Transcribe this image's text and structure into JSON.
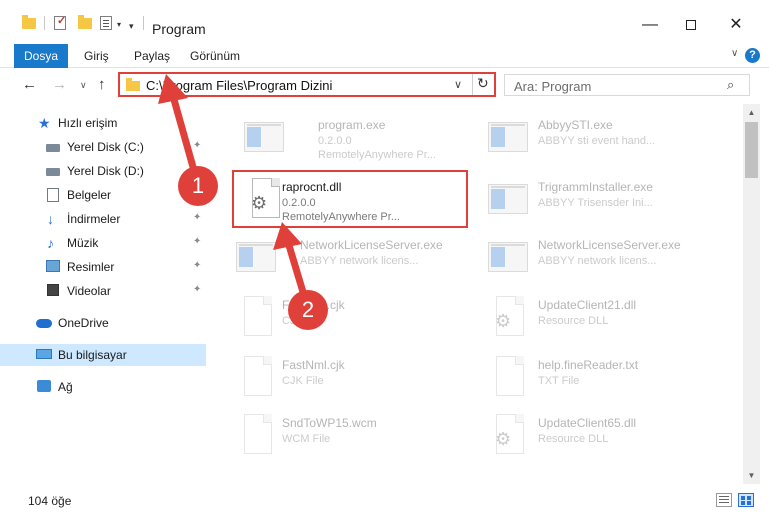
{
  "window": {
    "title": "Program",
    "minimize_glyph": "—",
    "close_glyph": "✕"
  },
  "ribbon": {
    "tabs": [
      "Dosya",
      "Giriş",
      "Paylaş",
      "Görünüm"
    ],
    "expand_glyph": "∨",
    "help_glyph": "?"
  },
  "nav": {
    "back_glyph": "←",
    "forward_glyph": "→",
    "recent_glyph": "∨",
    "up_glyph": "↑",
    "address": "C:\\Program Files\\Program Dizini",
    "dropdown_glyph": "∨",
    "refresh_glyph": "↻",
    "search_placeholder": "Ara: Program",
    "search_glyph": "⌕"
  },
  "sidebar": {
    "items": [
      {
        "label": "Hızlı erişim",
        "icon": "star-icon",
        "pinned": false
      },
      {
        "label": "Yerel Disk (C:)",
        "icon": "drive-icon",
        "pinned": true
      },
      {
        "label": "Yerel Disk (D:)",
        "icon": "drive-icon",
        "pinned": false
      },
      {
        "label": "Belgeler",
        "icon": "documents-icon",
        "pinned": true
      },
      {
        "label": "İndirmeler",
        "icon": "download-icon",
        "pinned": true
      },
      {
        "label": "Müzik",
        "icon": "music-icon",
        "pinned": true
      },
      {
        "label": "Resimler",
        "icon": "pictures-icon",
        "pinned": true
      },
      {
        "label": "Videolar",
        "icon": "videos-icon",
        "pinned": true
      },
      {
        "label": "OneDrive",
        "icon": "cloud-icon",
        "pinned": false
      },
      {
        "label": "Bu bilgisayar",
        "icon": "computer-icon",
        "pinned": false,
        "selected": true
      },
      {
        "label": "Ağ",
        "icon": "network-icon",
        "pinned": false
      }
    ],
    "pin_glyph": "📌"
  },
  "files": [
    {
      "name": "program.exe",
      "line1": "0.2.0.0",
      "line2": "RemotelyAnywhere Pr...",
      "icon": "installer-icon",
      "faded": true
    },
    {
      "name": "AbbyySTI.exe",
      "line1": "ABBYY sti event hand...",
      "line2": "",
      "icon": "application-icon",
      "faded": true
    },
    {
      "name": "raprocnt.dll",
      "line1": "0.2.0.0",
      "line2": "RemotelyAnywhere Pr...",
      "icon": "dll-gear-icon",
      "faded": false
    },
    {
      "name": "TrigrammInstaller.exe",
      "line1": "ABBYY Trisensder Ini...",
      "line2": "",
      "icon": "application-icon",
      "faded": true
    },
    {
      "name": "NetworkLicenseServer.exe",
      "line1": "ABBYY network licens...",
      "line2": "",
      "icon": "application-icon",
      "faded": true
    },
    {
      "name": "NetworkLicenseServer.exe",
      "line1": "ABBYY network licens...",
      "line2": "",
      "icon": "application-icon",
      "faded": true
    },
    {
      "name": "FastNml.cjk",
      "line1": "CJK File",
      "line2": "",
      "icon": "file-icon",
      "faded": true
    },
    {
      "name": "UpdateClient21.dll",
      "line1": "Resource DLL",
      "line2": "",
      "icon": "dll-gear-icon",
      "faded": true
    },
    {
      "name": "FastNml.cjk",
      "line1": "CJK File",
      "line2": "",
      "icon": "file-icon",
      "faded": true
    },
    {
      "name": "help.fineReader.txt",
      "line1": "TXT File",
      "line2": "",
      "icon": "file-icon",
      "faded": true
    },
    {
      "name": "SndToWP15.wcm",
      "line1": "WCM File",
      "line2": "",
      "icon": "file-icon",
      "faded": true
    },
    {
      "name": "UpdateClient65.dll",
      "line1": "Resource DLL",
      "line2": "",
      "icon": "dll-gear-icon",
      "faded": true
    }
  ],
  "status": {
    "item_count": "104 öğe"
  },
  "annotations": {
    "step1": "1",
    "step2": "2",
    "color": "#e0403a"
  },
  "colors": {
    "accent": "#1979ca",
    "selection": "#cde8ff",
    "highlight": "#e0403a"
  }
}
